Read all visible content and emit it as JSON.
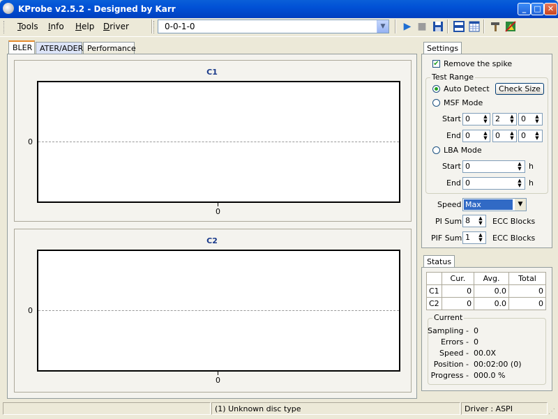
{
  "window": {
    "title": "KProbe v2.5.2 - Designed by Karr"
  },
  "menu": {
    "items": [
      {
        "label": "Tools",
        "underline": "T"
      },
      {
        "label": "Info",
        "underline": "I"
      },
      {
        "label": "Help",
        "underline": "H"
      },
      {
        "label": "Driver",
        "underline": "D"
      }
    ]
  },
  "drive": {
    "selected": "0-0-1-0"
  },
  "toolbar_icons": [
    "play-icon",
    "stop-icon",
    "save-icon",
    "split-view-icon",
    "table-icon",
    "tools-icon",
    "image-icon"
  ],
  "tabs": [
    {
      "label": "BLER",
      "active": true
    },
    {
      "label": "ATER/ADER",
      "active": false
    },
    {
      "label": "Performance",
      "active": false
    }
  ],
  "charts": [
    {
      "title": "C1",
      "y_tick": "0",
      "x_tick": "0"
    },
    {
      "title": "C2",
      "y_tick": "0",
      "x_tick": "0"
    }
  ],
  "chart_data": [
    {
      "type": "line",
      "title": "C1",
      "series": [],
      "yticks": [
        "0"
      ],
      "xticks": [
        "0"
      ]
    },
    {
      "type": "line",
      "title": "C2",
      "series": [],
      "yticks": [
        "0"
      ],
      "xticks": [
        "0"
      ]
    }
  ],
  "settings": {
    "tab_label": "Settings",
    "remove_spike": {
      "label": "Remove the spike",
      "checked": true
    },
    "test_range": {
      "legend": "Test Range",
      "auto_detect": "Auto Detect",
      "check_size": "Check Size",
      "msf_mode": "MSF Mode",
      "msf_start_label": "Start",
      "msf_start": [
        "0",
        "2",
        "0"
      ],
      "msf_end_label": "End",
      "msf_end": [
        "0",
        "0",
        "0"
      ],
      "lba_mode": "LBA Mode",
      "lba_start_label": "Start",
      "lba_start": "0",
      "lba_end_label": "End",
      "lba_end": "0",
      "unit": "h",
      "selected_mode": "Auto Detect"
    },
    "speed_label": "Speed",
    "speed_value": "Max",
    "pi_sum_label": "PI Sum",
    "pi_sum_value": "8",
    "pif_sum_label": "PIF Sum",
    "pif_sum_value": "1",
    "ecc_blocks": "ECC Blocks"
  },
  "status": {
    "tab_label": "Status",
    "headers": [
      "",
      "Cur.",
      "Avg.",
      "Total"
    ],
    "rows": [
      [
        "C1",
        "0",
        "0.0",
        "0"
      ],
      [
        "C2",
        "0",
        "0.0",
        "0"
      ]
    ],
    "current": {
      "legend": "Current",
      "sampling_label": "Sampling -",
      "sampling": "0",
      "errors_label": "Errors -",
      "errors": "0",
      "speed_label": "Speed -",
      "speed": "00.0X",
      "position_label": "Position -",
      "position": "00:02:00 (0)",
      "progress_label": "Progress -",
      "progress": "000.0 %"
    }
  },
  "statusbar": {
    "disc": "(1) Unknown disc type",
    "driver": "Driver : ASPI"
  },
  "colors": {
    "titlebar": "#0151d6",
    "accent_green": "#21a121",
    "chart_title": "#1a3a8a",
    "tab_highlight": "#e68b2c"
  }
}
